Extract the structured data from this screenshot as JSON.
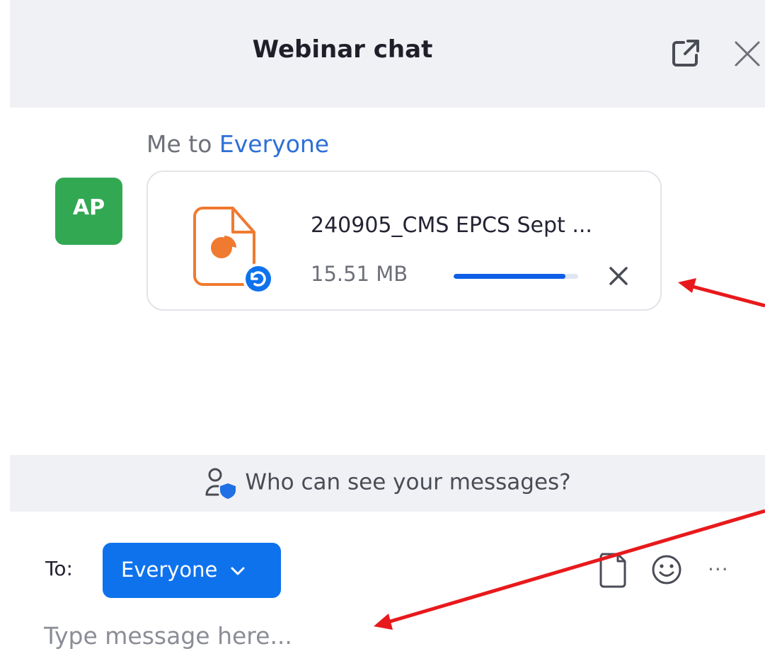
{
  "header": {
    "title": "Webinar chat",
    "popout_icon": "popout-icon",
    "close_icon": "close-icon"
  },
  "message": {
    "sender": "Me",
    "connector": "to",
    "recipient": "Everyone",
    "avatar_initials": "AP",
    "avatar_color": "#33a853",
    "file": {
      "name": "240905_CMS EPCS Sept ...",
      "size": "15.51 MB",
      "icon": "presentation-file-icon",
      "status_icon": "uploading-icon",
      "upload_progress": 0.9
    }
  },
  "privacy": {
    "label": "Who can see your messages?",
    "icon": "user-shield-icon"
  },
  "composer": {
    "to_label": "To:",
    "recipient": "Everyone",
    "placeholder": "Type message here...",
    "more_label": "···",
    "attach_icon": "file-icon",
    "emoji_icon": "emoji-icon"
  },
  "colors": {
    "accent": "#0e72ed",
    "link": "#2d6fd6",
    "file_accent": "#f07a2f",
    "annotation": "#e8191c",
    "header_bg": "#f0f1f4"
  }
}
